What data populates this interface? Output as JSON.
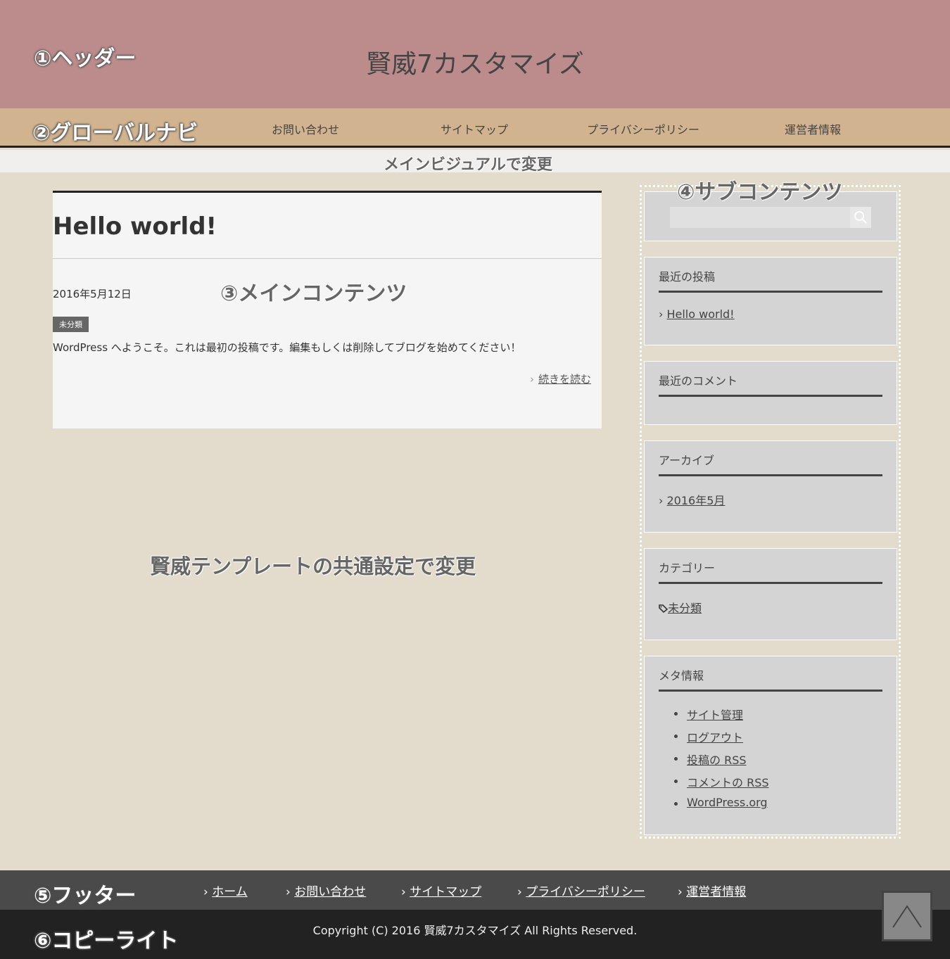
{
  "annotations": {
    "header": "①ヘッダー",
    "gnav": "②グローバルナビ",
    "main_content": "③メインコンテンツ",
    "sub_content": "④サブコンテンツ",
    "footer": "⑤フッター",
    "copyright": "⑥コピーライト",
    "main_visual_note": "メインビジュアルで変更",
    "common_settings_note": "賢威テンプレートの共通設定で変更"
  },
  "header": {
    "site_title": "賢威7カスタマイズ"
  },
  "gnav": {
    "items": [
      "お問い合わせ",
      "サイトマップ",
      "プライバシーポリシー",
      "運営者情報"
    ]
  },
  "post": {
    "title": "Hello world!",
    "date": "2016年5月12日",
    "category": "未分類",
    "excerpt": "WordPress へようこそ。これは最初の投稿です。編集もしくは削除してブログを始めてください！",
    "read_more": "続きを読む"
  },
  "sidebar": {
    "search": {
      "placeholder": ""
    },
    "recent_posts": {
      "title": "最近の投稿",
      "items": [
        "Hello world!"
      ]
    },
    "recent_comments": {
      "title": "最近のコメント"
    },
    "archives": {
      "title": "アーカイブ",
      "items": [
        "2016年5月"
      ]
    },
    "categories": {
      "title": "カテゴリー",
      "items": [
        "未分類"
      ]
    },
    "meta": {
      "title": "メタ情報",
      "items": [
        "サイト管理",
        "ログアウト",
        "投稿の RSS",
        "コメントの RSS",
        "WordPress.org"
      ]
    }
  },
  "footer": {
    "nav": [
      "ホーム",
      "お問い合わせ",
      "サイトマップ",
      "プライバシーポリシー",
      "運営者情報"
    ],
    "copyright": "Copyright (C) 2016 賢威7カスタマイズ All Rights Reserved."
  },
  "colors": {
    "header_bg": "#bc8c8c",
    "gnav_bg": "#d2b38f",
    "body_bg": "#e3dccd",
    "footer_bg": "#4a4a4a",
    "copyright_bg": "#222222"
  }
}
